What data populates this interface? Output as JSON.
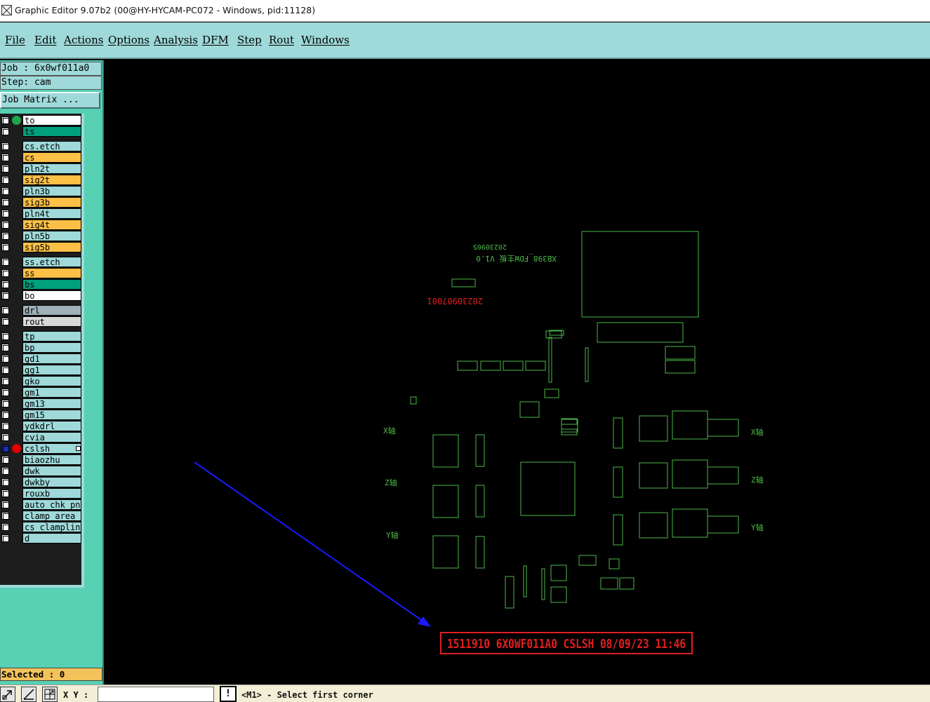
{
  "window": {
    "title": "Graphic Editor 9.07b2 (00@HY-HYCAM-PC072 - Windows, pid:11128)",
    "app_icon": "graphic-editor-icon"
  },
  "menu": [
    "File",
    "Edit",
    "Actions",
    "Options",
    "Analysis",
    "DFM",
    "Step",
    "Rout",
    "Windows"
  ],
  "panel": {
    "job_line": "Job : 6x0wf011a0",
    "step_line": "Step: cam",
    "job_matrix_label": "Job Matrix ...",
    "selected_line": "Selected : 0"
  },
  "colors": {
    "board": "#14ab4a",
    "signal": "#fcc046",
    "etch": "#9fd9d9",
    "mask": "#00a07c",
    "drill": "#9fb0b8",
    "rout": "#d8d8d8",
    "plain": "#ffffff",
    "work_dot": "#e20000",
    "display_dot": "#1fa64a",
    "pcb_green": "#4db84a",
    "stamp_red": "#e01f1f",
    "arrow_blue": "#1a1aff",
    "canvas_bg": "#000000"
  },
  "layers": [
    {
      "name": "to",
      "color": "#ffffff",
      "indicator": "#1fa64a"
    },
    {
      "name": "ts",
      "color": "#00a07c"
    },
    {
      "name": "cs.etch",
      "color": "#9fd9d9"
    },
    {
      "name": "cs",
      "color": "#fcc046"
    },
    {
      "name": "pln2t",
      "color": "#9fd9d9"
    },
    {
      "name": "sig2t",
      "color": "#fcc046"
    },
    {
      "name": "pln3b",
      "color": "#9fd9d9"
    },
    {
      "name": "sig3b",
      "color": "#fcc046"
    },
    {
      "name": "pln4t",
      "color": "#9fd9d9"
    },
    {
      "name": "sig4t",
      "color": "#fcc046"
    },
    {
      "name": "pln5b",
      "color": "#9fd9d9"
    },
    {
      "name": "sig5b",
      "color": "#fcc046"
    },
    {
      "name": "ss.etch",
      "color": "#9fd9d9"
    },
    {
      "name": "ss",
      "color": "#fcc046"
    },
    {
      "name": "bs",
      "color": "#00a07c"
    },
    {
      "name": "bo",
      "color": "#ffffff"
    },
    {
      "name": "drl",
      "color": "#9fb0b8"
    },
    {
      "name": "rout",
      "color": "#d8d8d8"
    },
    {
      "name": "tp",
      "color": "#9fd9d9"
    },
    {
      "name": "bp",
      "color": "#9fd9d9"
    },
    {
      "name": "gd1",
      "color": "#9fd9d9"
    },
    {
      "name": "gg1",
      "color": "#9fd9d9"
    },
    {
      "name": "gko",
      "color": "#9fd9d9"
    },
    {
      "name": "gm1",
      "color": "#9fd9d9"
    },
    {
      "name": "gm13",
      "color": "#9fd9d9"
    },
    {
      "name": "gm15",
      "color": "#9fd9d9"
    },
    {
      "name": "ydkdrl",
      "color": "#9fd9d9"
    },
    {
      "name": "cvia",
      "color": "#9fd9d9"
    },
    {
      "name": "cslsh",
      "color": "#9fd9d9",
      "indicator": "#e20000",
      "selected": true
    },
    {
      "name": "biaozhu",
      "color": "#9fd9d9"
    },
    {
      "name": "dwk",
      "color": "#9fd9d9"
    },
    {
      "name": "dwkby",
      "color": "#9fd9d9"
    },
    {
      "name": "rouxb",
      "color": "#9fd9d9"
    },
    {
      "name": "auto_chk_pnl",
      "color": "#9fd9d9"
    },
    {
      "name": "clamp_area",
      "color": "#9fd9d9"
    },
    {
      "name": "cs_clampline",
      "color": "#9fd9d9"
    },
    {
      "name": "d",
      "color": "#9fd9d9"
    }
  ],
  "canvas": {
    "board_title": "XB398_FDW主板 V1.0",
    "board_date": "20230905",
    "date_code": "20230907001",
    "stamp": "1511910 6X0WF011A0 CSLSH 08/09/23 11:46"
  },
  "statusbar": {
    "xy_label": "X Y :",
    "xy_value": "",
    "exclaim": "!",
    "prompt": "<M1> - Select first corner",
    "tool_icons": [
      "zoom-box-icon",
      "measure-icon",
      "snap-grid-icon"
    ]
  }
}
